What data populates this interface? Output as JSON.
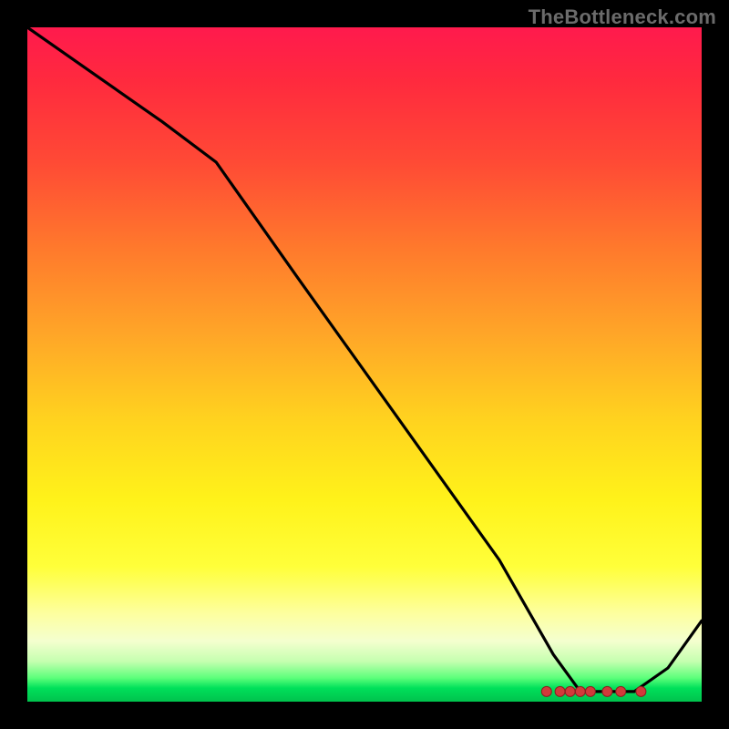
{
  "watermark": "TheBottleneck.com",
  "chart_data": {
    "type": "line",
    "title": "",
    "xlabel": "",
    "ylabel": "",
    "xlim": [
      0,
      100
    ],
    "ylim": [
      0,
      100
    ],
    "grid": false,
    "legend": false,
    "series": [
      {
        "name": "main-curve",
        "color": "#000000",
        "x": [
          0,
          10,
          20,
          28,
          40,
          55,
          70,
          78,
          82,
          86,
          90,
          95,
          100
        ],
        "values": [
          100,
          93,
          86,
          80,
          63,
          42,
          21,
          7,
          1.5,
          1.5,
          1.5,
          5,
          12
        ]
      }
    ],
    "markers": [
      {
        "name": "marker-dot",
        "shape": "circle",
        "color": "#d13b3b",
        "x": 77,
        "y": 1.5
      },
      {
        "name": "marker-dot",
        "shape": "circle",
        "color": "#d13b3b",
        "x": 79,
        "y": 1.5
      },
      {
        "name": "marker-dot",
        "shape": "circle",
        "color": "#d13b3b",
        "x": 80.5,
        "y": 1.5
      },
      {
        "name": "marker-dot",
        "shape": "circle",
        "color": "#d13b3b",
        "x": 82,
        "y": 1.5
      },
      {
        "name": "marker-dot",
        "shape": "circle",
        "color": "#d13b3b",
        "x": 83.5,
        "y": 1.5
      },
      {
        "name": "marker-dot",
        "shape": "circle",
        "color": "#d13b3b",
        "x": 86,
        "y": 1.5
      },
      {
        "name": "marker-dot",
        "shape": "circle",
        "color": "#d13b3b",
        "x": 88,
        "y": 1.5
      },
      {
        "name": "marker-dot",
        "shape": "circle",
        "color": "#d13b3b",
        "x": 91,
        "y": 1.5
      }
    ],
    "gradient_stops": [
      {
        "pos": 0,
        "color": "#ff1a4d"
      },
      {
        "pos": 33,
        "color": "#ff7a2c"
      },
      {
        "pos": 70,
        "color": "#fff21a"
      },
      {
        "pos": 91,
        "color": "#f4ffcf"
      },
      {
        "pos": 100,
        "color": "#00c24d"
      }
    ]
  }
}
